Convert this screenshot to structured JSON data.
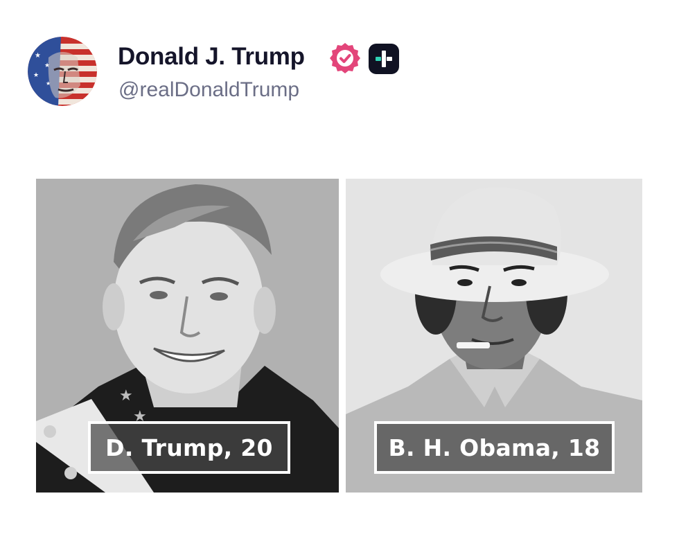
{
  "author": {
    "display_name": "Donald J. Trump",
    "handle": "@realDonaldTrump",
    "verified_icon": "verified-badge-icon",
    "verified_color": "#e3457a",
    "plus_icon": "plus-badge-icon"
  },
  "media": {
    "left_photo": {
      "icon": "portrait-photo",
      "caption": "D. Trump, 20"
    },
    "right_photo": {
      "icon": "portrait-photo",
      "caption": "B. H. Obama, 18"
    }
  },
  "colors": {
    "text_primary": "#15152a",
    "text_secondary": "#6b6e86",
    "background": "#ffffff"
  }
}
